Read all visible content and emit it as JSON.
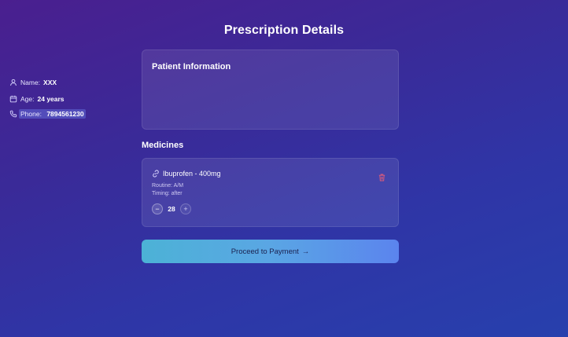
{
  "page": {
    "title": "Prescription Details"
  },
  "patient": {
    "section_title": "Patient Information",
    "name_label": "Name:",
    "name_value": "XXX",
    "age_label": "Age:",
    "age_value": "24 years",
    "phone_label": "Phone:",
    "phone_value": "7894561230",
    "icons": {
      "name": "user-icon",
      "age": "calendar-icon",
      "phone": "phone-icon"
    }
  },
  "medicines": {
    "section_title": "Medicines",
    "items": [
      {
        "name": "Ibuprofen - 400mg",
        "routine": "Routine: A/M",
        "timing": "Timing: after",
        "quantity": "28",
        "decrement": "−",
        "increment": "+",
        "icon": "pill-link-icon",
        "delete_icon": "trash-icon",
        "delete_color": "#e25c7a"
      }
    ]
  },
  "actions": {
    "proceed_label": "Proceed to Payment",
    "proceed_arrow": "→"
  }
}
